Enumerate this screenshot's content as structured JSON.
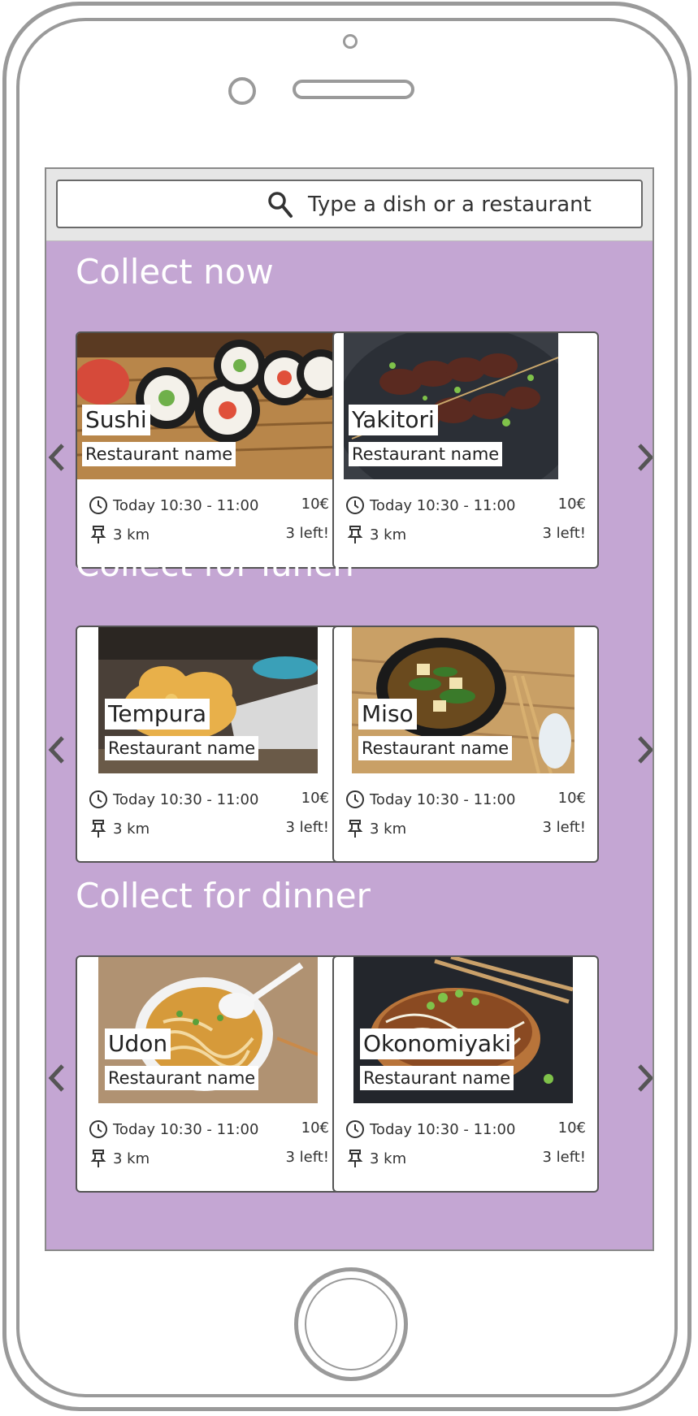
{
  "search": {
    "placeholder": "Type a dish or a restaurant"
  },
  "sections": [
    {
      "title": "Collect now",
      "cards": [
        {
          "dish": "Sushi",
          "restaurant": "Restaurant name",
          "time": "Today 10:30 - 11:00",
          "price": "10€",
          "distance": "3 km",
          "left": "3 left!"
        },
        {
          "dish": "Yakitori",
          "restaurant": "Restaurant name",
          "time": "Today 10:30 - 11:00",
          "price": "10€",
          "distance": "3 km",
          "left": "3 left!"
        }
      ]
    },
    {
      "title": "Collect for lunch",
      "cards": [
        {
          "dish": "Tempura",
          "restaurant": "Restaurant name",
          "time": "Today 10:30 - 11:00",
          "price": "10€",
          "distance": "3 km",
          "left": "3 left!"
        },
        {
          "dish": "Miso",
          "restaurant": "Restaurant name",
          "time": "Today 10:30 - 11:00",
          "price": "10€",
          "distance": "3 km",
          "left": "3 left!"
        }
      ]
    },
    {
      "title": "Collect for dinner",
      "cards": [
        {
          "dish": "Udon",
          "restaurant": "Restaurant name",
          "time": "Today 10:30 - 11:00",
          "price": "10€",
          "distance": "3 km",
          "left": "3 left!"
        },
        {
          "dish": "Okonomiyaki",
          "restaurant": "Restaurant name",
          "time": "Today 10:30 - 11:00",
          "price": "10€",
          "distance": "3 km",
          "left": "3 left!"
        }
      ]
    }
  ],
  "colors": {
    "screen_bg": "#c4a6d3",
    "title_text": "#ffffff",
    "frame": "#9a9a9a"
  },
  "icons": {
    "search": "search-icon",
    "clock": "clock-icon",
    "distance": "pin-icon",
    "prev": "chevron-left-icon",
    "next": "chevron-right-icon"
  }
}
